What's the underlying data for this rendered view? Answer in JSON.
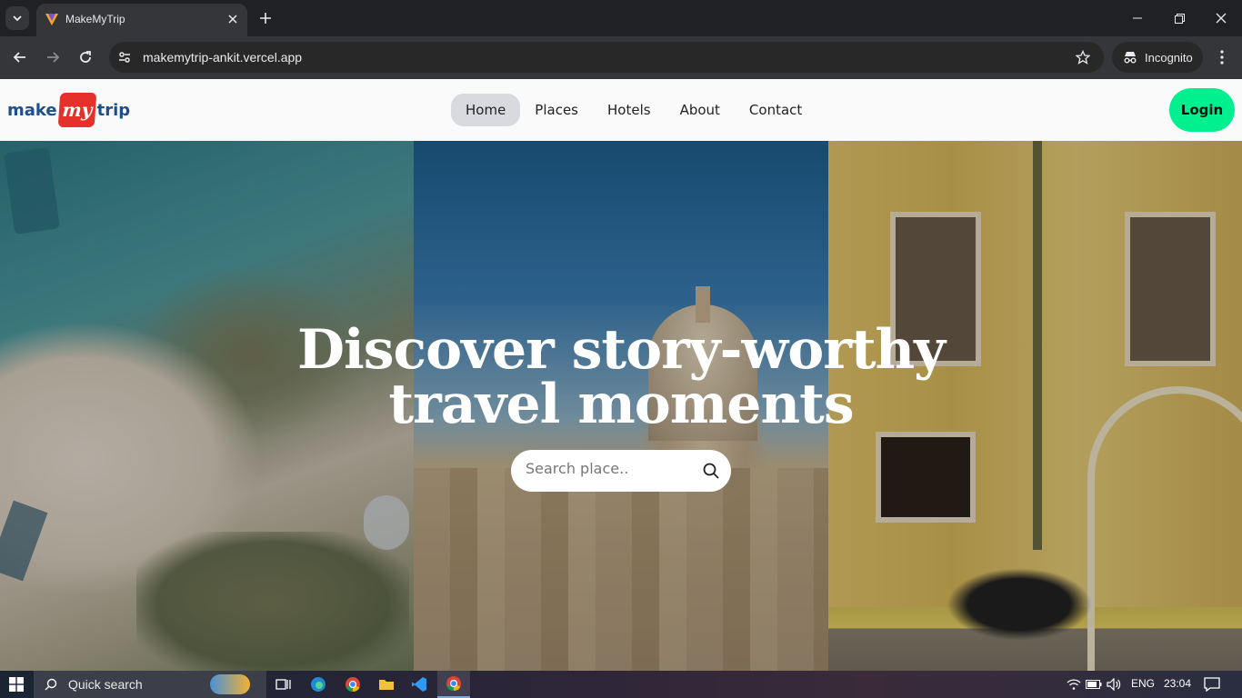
{
  "browser": {
    "tab_title": "MakeMyTrip",
    "url": "makemytrip-ankit.vercel.app",
    "incognito_label": "Incognito"
  },
  "site": {
    "logo": {
      "left": "make",
      "badge": "my",
      "right": "trip"
    },
    "nav": [
      {
        "label": "Home",
        "active": true
      },
      {
        "label": "Places",
        "active": false
      },
      {
        "label": "Hotels",
        "active": false
      },
      {
        "label": "About",
        "active": false
      },
      {
        "label": "Contact",
        "active": false
      }
    ],
    "login_label": "Login"
  },
  "hero": {
    "title_line1": "Discover story-worthy",
    "title_line2": "travel moments",
    "search_placeholder": "Search place.."
  },
  "taskbar": {
    "search_label": "Quick search",
    "language": "ENG",
    "time": "23:04"
  },
  "colors": {
    "login_button": "#00f090",
    "logo_red": "#e4322b",
    "logo_blue": "#1e4e8c",
    "active_nav_bg": "#d9d9e0"
  }
}
